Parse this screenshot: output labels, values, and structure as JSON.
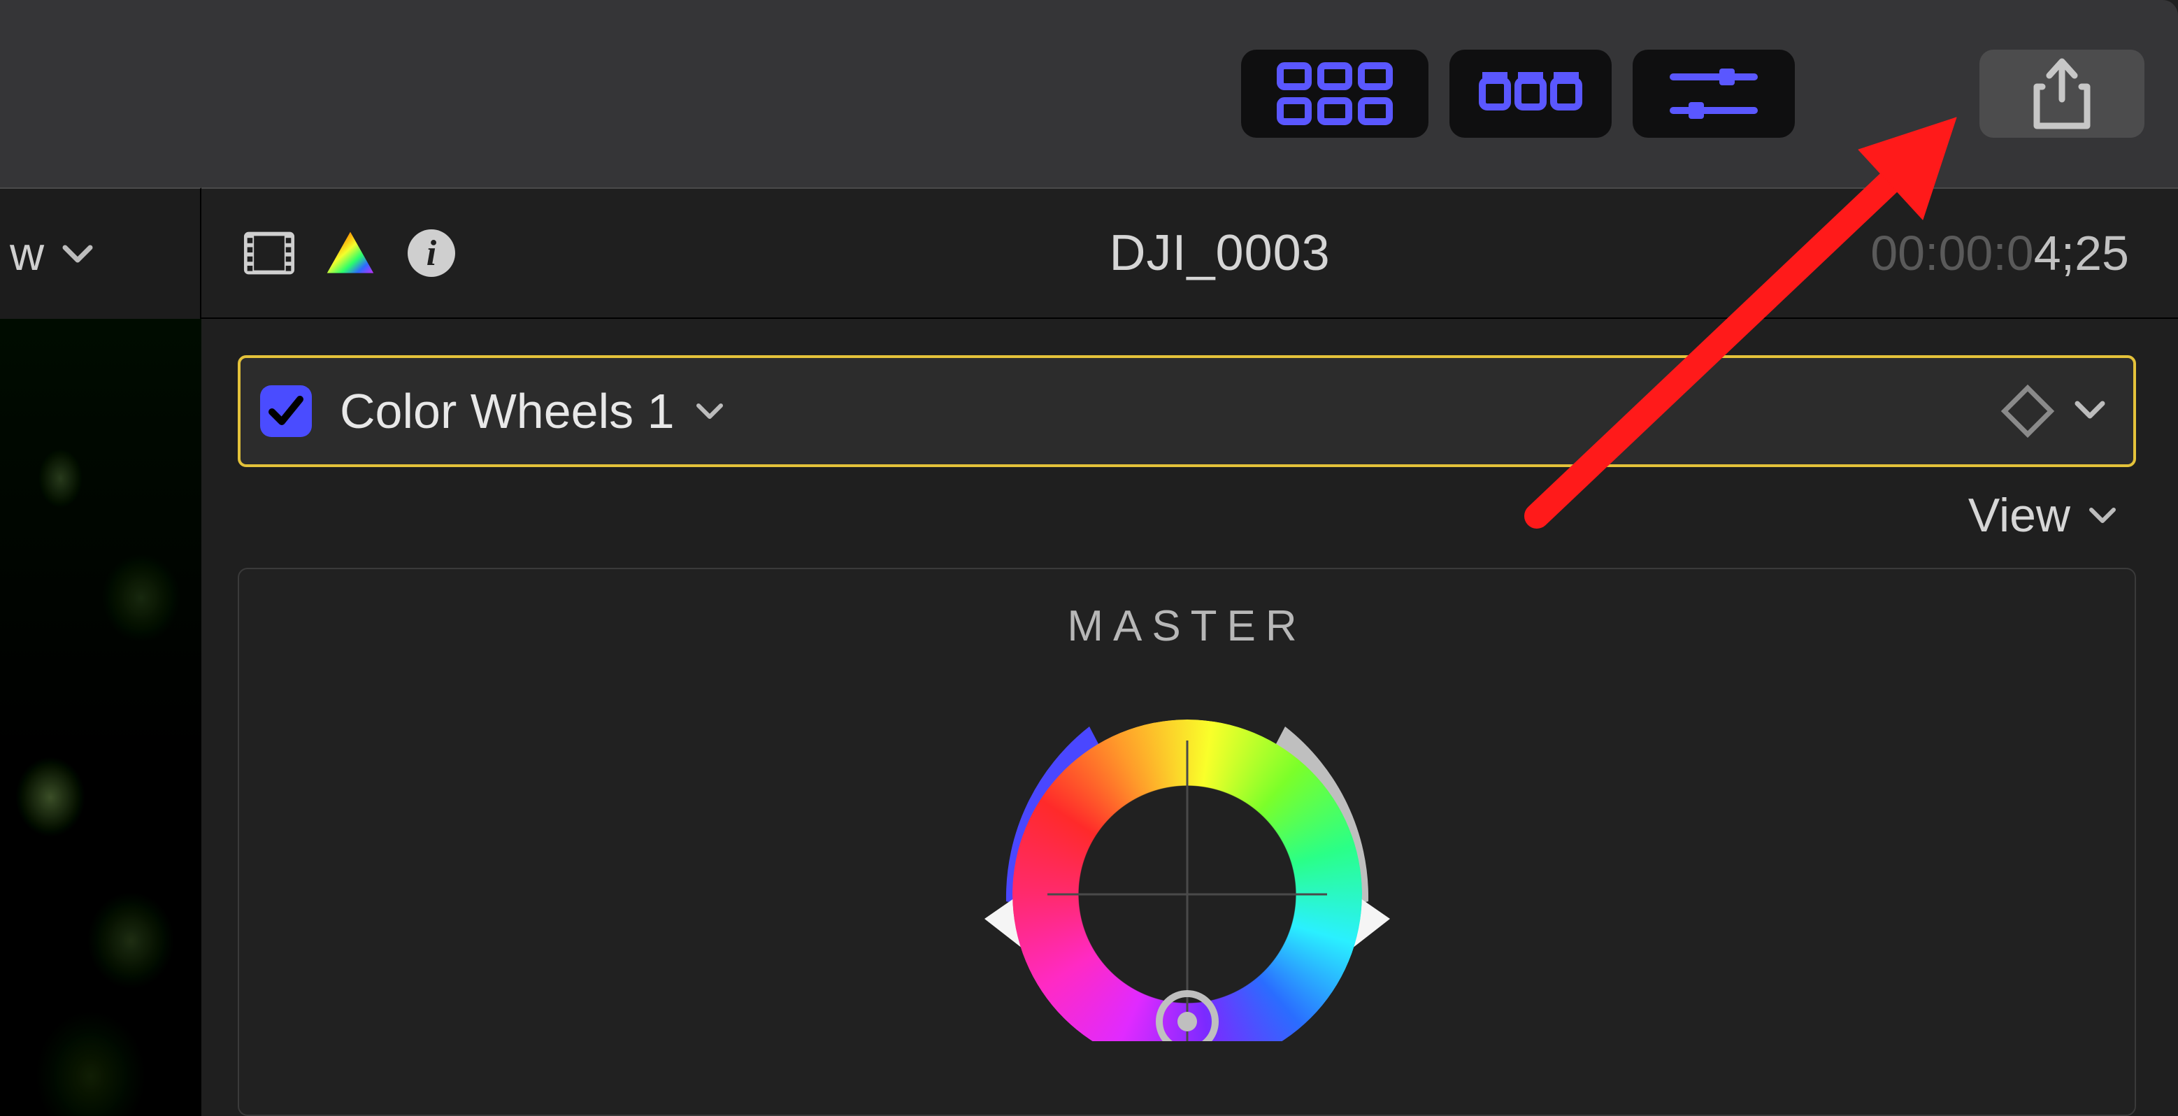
{
  "left_header": {
    "label_suffix": "w"
  },
  "toolbar": {
    "share_tooltip": "Share"
  },
  "clip": {
    "title": "DJI_0003",
    "time_dim": "00:00:0",
    "time_bright": "4;25"
  },
  "effect": {
    "name": "Color Wheels 1"
  },
  "view_menu": {
    "label": "View"
  },
  "wheel": {
    "label": "MASTER"
  }
}
